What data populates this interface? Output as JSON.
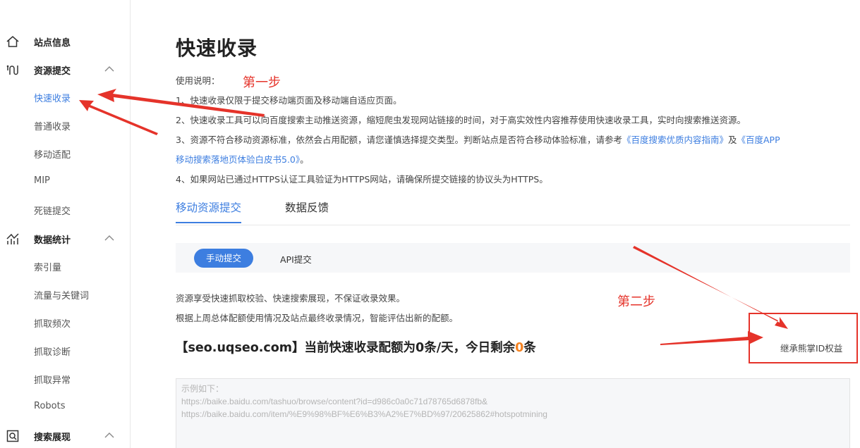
{
  "sidebar": {
    "groups": [
      {
        "label": "站点信息",
        "icon": "home-icon"
      },
      {
        "label": "资源提交",
        "icon": "submit-icon"
      },
      {
        "label": "数据统计",
        "icon": "stats-icon"
      },
      {
        "label": "搜索展现",
        "icon": "search-display-icon"
      }
    ],
    "items": [
      {
        "label": "快速收录",
        "active": true
      },
      {
        "label": "普通收录"
      },
      {
        "label": "移动适配"
      },
      {
        "label": "MIP"
      },
      {
        "label": "死链提交"
      },
      {
        "label": "索引量"
      },
      {
        "label": "流量与关键词"
      },
      {
        "label": "抓取频次"
      },
      {
        "label": "抓取诊断"
      },
      {
        "label": "抓取异常"
      },
      {
        "label": "Robots"
      }
    ]
  },
  "main": {
    "title": "快速收录",
    "usage_label": "使用说明：",
    "steps": {
      "step1": "第一步",
      "step2": "第二步"
    },
    "lines": [
      "1、快速收录仅限于提交移动端页面及移动端自适应页面。",
      "2、快速收录工具可以向百度搜索主动推送资源，缩短爬虫发现网站链接的时间，对于高实效性内容推荐使用快速收录工具，实时向搜索推送资源。",
      "3、资源不符合移动资源标准，依然会占用配额，请您谨慎选择提交类型。判断站点是否符合移动体验标准，请参考",
      "。",
      "4、如果网站已通过HTTPS认证工具验证为HTTPS网站，请确保所提交链接的协议头为HTTPS。"
    ],
    "link1": "《百度搜索优质内容指南》",
    "and": "及",
    "link2a": "《百度APP",
    "link2b": "移动搜索落地页体验白皮书5.0》",
    "tabs": [
      "移动资源提交",
      "数据反馈"
    ],
    "subtabs": [
      "手动提交",
      "API提交"
    ],
    "info1": "资源享受快速抓取校验、快速搜索展现，不保证收录效果。",
    "info2": "根据上周总体配额使用情况及站点最终收录情况，智能评估出新的配额。",
    "quota_prefix": "【seo.uqseo.com】当前快速收录配额为0条/天，今日剩余",
    "quota_remaining": "0",
    "quota_suffix": "条",
    "inherit_link": "继承熊掌ID权益",
    "textarea_placeholder": "示例如下：\nhttps://baike.baidu.com/tashuo/browse/content?id=d986c0a0c71d78765d6878fb&\nhttps://baike.baidu.com/item/%E9%98%BF%E6%B3%A2%E7%BD%97/20625862#hotspotmining"
  },
  "colors": {
    "accent": "#3d7ee0",
    "annotation": "#e5332a",
    "highlight": "#f58220"
  }
}
